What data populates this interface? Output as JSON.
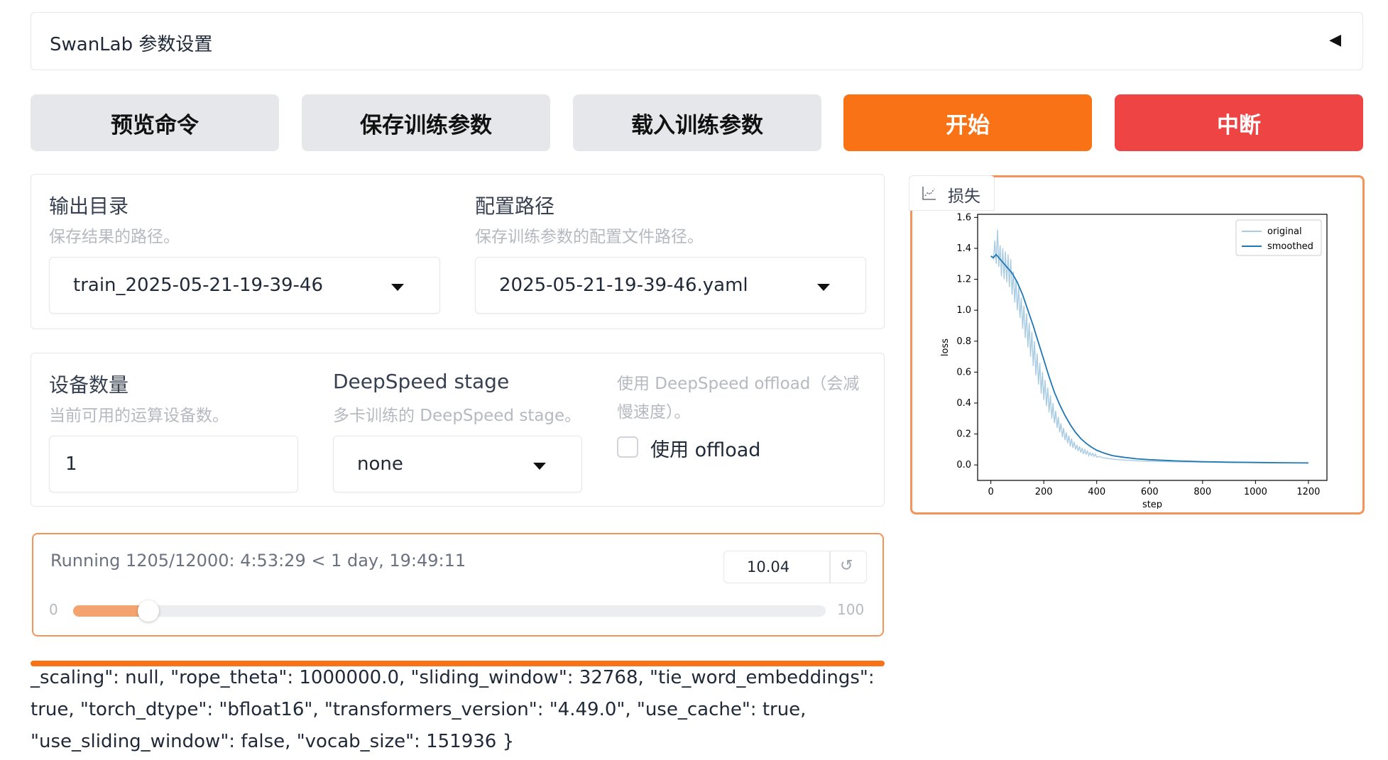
{
  "accordion": {
    "title": "SwanLab 参数设置",
    "caret": "◀"
  },
  "buttons": {
    "preview": "预览命令",
    "save": "保存训练参数",
    "load": "载入训练参数",
    "start": "开始",
    "abort": "中断"
  },
  "output": {
    "output_dir_label": "输出目录",
    "output_dir_info": "保存结果的路径。",
    "output_dir_value": "train_2025-05-21-19-39-46",
    "config_path_label": "配置路径",
    "config_path_info": "保存训练参数的配置文件路径。",
    "config_path_value": "2025-05-21-19-39-46.yaml"
  },
  "device": {
    "device_count_label": "设备数量",
    "device_count_info": "当前可用的运算设备数。",
    "device_count_value": "1",
    "ds_stage_label": "DeepSpeed stage",
    "ds_stage_info": "多卡训练的 DeepSpeed stage。",
    "ds_stage_value": "none",
    "ds_offload_info": "使用 DeepSpeed offload（会减慢速度）。",
    "ds_offload_label": "使用 offload",
    "ds_offload_checked": false
  },
  "progress": {
    "status": "Running 1205/12000: 4:53:29 < 1 day, 19:49:11",
    "value": "10.04",
    "fraction": 0.1004,
    "min": "0",
    "max": "100",
    "reset_icon": "↺"
  },
  "log": "_scaling\": null, \"rope_theta\": 1000000.0, \"sliding_window\": 32768, \"tie_word_embeddings\": true, \"torch_dtype\": \"bfloat16\", \"transformers_version\": \"4.49.0\", \"use_cache\": true, \"use_sliding_window\": false, \"vocab_size\": 151936 }",
  "plot": {
    "tab_label": "损失",
    "tab_icon": "chart-icon"
  },
  "chart_data": {
    "type": "line",
    "title": "",
    "xlabel": "step",
    "ylabel": "loss",
    "xlim": [
      -50,
      1270
    ],
    "ylim": [
      -0.1,
      1.62
    ],
    "xticks": [
      0,
      200,
      400,
      600,
      800,
      1000,
      1200
    ],
    "yticks": [
      0.0,
      0.2,
      0.4,
      0.6,
      0.8,
      1.0,
      1.2,
      1.4,
      1.6
    ],
    "legend_position": "top-right",
    "series": [
      {
        "name": "original",
        "color": "#a9cce3",
        "x": [
          0,
          10,
          15,
          20,
          25,
          30,
          35,
          40,
          45,
          50,
          55,
          60,
          65,
          70,
          75,
          80,
          85,
          90,
          95,
          100,
          105,
          110,
          115,
          120,
          125,
          130,
          135,
          140,
          145,
          150,
          155,
          160,
          165,
          170,
          175,
          180,
          185,
          190,
          195,
          200,
          205,
          210,
          215,
          220,
          225,
          230,
          235,
          240,
          245,
          250,
          255,
          260,
          265,
          270,
          275,
          280,
          285,
          290,
          295,
          300,
          305,
          310,
          315,
          320,
          325,
          330,
          335,
          340,
          345,
          350,
          355,
          360,
          365,
          370,
          375,
          380,
          385,
          390,
          395,
          400,
          410,
          420,
          430,
          440,
          450,
          460,
          470,
          480,
          500,
          520,
          540,
          560,
          600,
          650,
          700,
          800,
          900,
          1000,
          1100,
          1200
        ],
        "values": [
          1.35,
          1.33,
          1.45,
          1.3,
          1.52,
          1.28,
          1.42,
          1.22,
          1.4,
          1.2,
          1.38,
          1.18,
          1.36,
          1.15,
          1.33,
          1.1,
          1.25,
          1.05,
          1.2,
          1.0,
          1.15,
          0.95,
          1.08,
          0.88,
          1.03,
          0.82,
          0.98,
          0.76,
          0.92,
          0.7,
          0.86,
          0.64,
          0.8,
          0.58,
          0.72,
          0.52,
          0.66,
          0.46,
          0.6,
          0.42,
          0.55,
          0.38,
          0.5,
          0.34,
          0.45,
          0.3,
          0.4,
          0.27,
          0.35,
          0.24,
          0.31,
          0.21,
          0.27,
          0.18,
          0.24,
          0.16,
          0.21,
          0.14,
          0.19,
          0.12,
          0.17,
          0.11,
          0.15,
          0.1,
          0.13,
          0.09,
          0.12,
          0.08,
          0.11,
          0.07,
          0.1,
          0.07,
          0.09,
          0.06,
          0.08,
          0.06,
          0.075,
          0.055,
          0.07,
          0.05,
          0.055,
          0.048,
          0.045,
          0.042,
          0.04,
          0.038,
          0.036,
          0.034,
          0.032,
          0.03,
          0.028,
          0.026,
          0.024,
          0.022,
          0.02,
          0.018,
          0.016,
          0.015,
          0.014,
          0.013
        ]
      },
      {
        "name": "smoothed",
        "color": "#1f77b4",
        "x": [
          0,
          10,
          20,
          40,
          60,
          80,
          100,
          120,
          140,
          160,
          180,
          200,
          220,
          240,
          260,
          280,
          300,
          320,
          340,
          360,
          380,
          400,
          430,
          460,
          500,
          550,
          600,
          700,
          800,
          900,
          1000,
          1100,
          1200
        ],
        "values": [
          1.35,
          1.34,
          1.36,
          1.32,
          1.28,
          1.24,
          1.18,
          1.1,
          1.0,
          0.9,
          0.79,
          0.68,
          0.57,
          0.47,
          0.39,
          0.32,
          0.26,
          0.21,
          0.17,
          0.14,
          0.115,
          0.095,
          0.075,
          0.06,
          0.05,
          0.04,
          0.034,
          0.026,
          0.021,
          0.018,
          0.016,
          0.014,
          0.013
        ]
      }
    ]
  }
}
